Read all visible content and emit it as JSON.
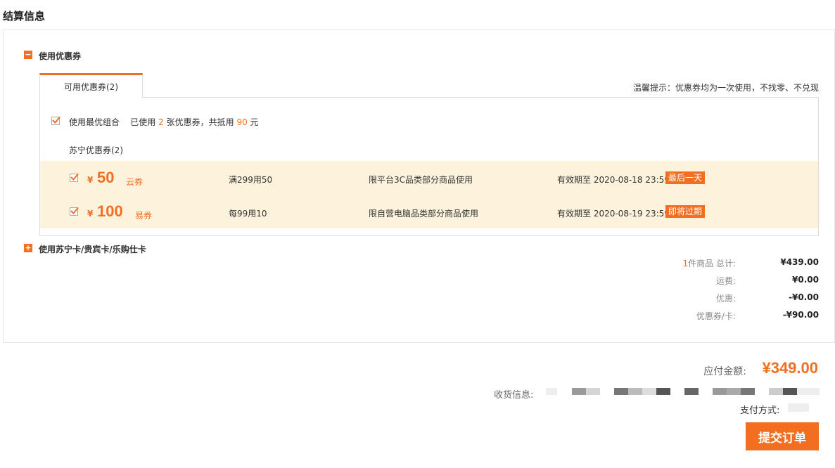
{
  "section_title": "结算信息",
  "coupon_section": {
    "toggle_icon": "minus-icon",
    "label": "使用优惠券",
    "tab_label": "可用优惠券(2)",
    "tip": "温馨提示：优惠券均为一次使用，不找零、不兑现",
    "best_combo": {
      "checked": true,
      "label": "使用最优组合",
      "used_prefix": "已使用",
      "used_count": "2",
      "used_mid": "张优惠券，共抵用",
      "amount": "90",
      "unit": "元"
    },
    "group_title": "苏宁优惠券(2)",
    "coupons": [
      {
        "checked": true,
        "currency": "¥",
        "value": "50",
        "type": "云券",
        "condition": "满299用50",
        "scope": "限平台3C品类部分商品使用",
        "validity": "有效期至 2020-08-18 23:59",
        "tag": "最后一天"
      },
      {
        "checked": true,
        "currency": "¥",
        "value": "100",
        "type": "易券",
        "condition": "每99用10",
        "scope": "限自营电脑品类部分商品使用",
        "validity": "有效期至 2020-08-19 23:59",
        "tag": "即将过期"
      }
    ]
  },
  "card_section": {
    "toggle_icon": "plus-icon",
    "label": "使用苏宁卡/贵宾卡/乐购仕卡"
  },
  "summary": {
    "items_count": "1",
    "items_label": "件商品 总计:",
    "items_total": "¥439.00",
    "shipping_label": "运费:",
    "shipping": "¥0.00",
    "discount_label": "优惠:",
    "discount": "-¥0.00",
    "coupon_label": "优惠券/卡:",
    "coupon": "-¥90.00"
  },
  "payable": {
    "label": "应付金额:",
    "amount": "¥349.00"
  },
  "shipping_info_label": "收货信息:",
  "payment_method_label": "支付方式:",
  "submit_label": "提交订单",
  "colors": {
    "accent": "#f26f21",
    "coupon_bg": "#fdf3dc"
  }
}
